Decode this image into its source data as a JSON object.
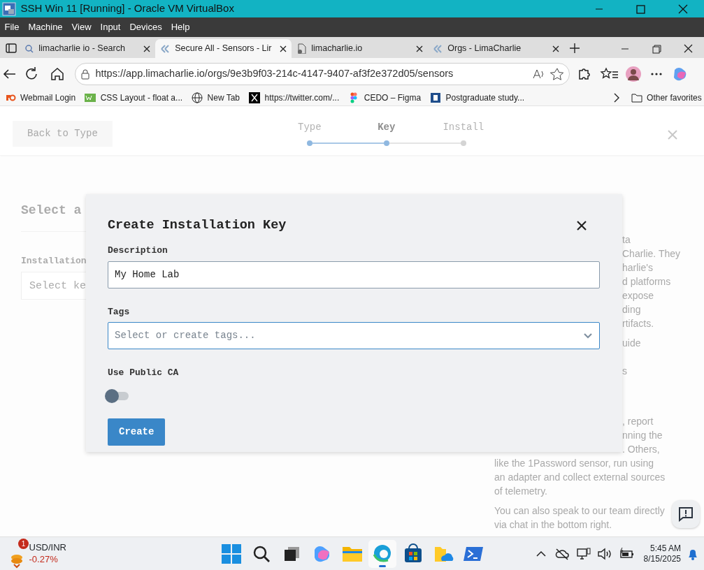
{
  "vm_window": {
    "title": "SSH Win 11 [Running] - Oracle VM VirtualBox"
  },
  "vm_menu": [
    "File",
    "Machine",
    "View",
    "Input",
    "Devices",
    "Help"
  ],
  "browser": {
    "tabs": [
      {
        "label": "limacharlie io - Search",
        "selected": false
      },
      {
        "label": "Secure All - Sensors - Lir",
        "selected": true
      },
      {
        "label": "limacharlie.io",
        "selected": false
      },
      {
        "label": "Orgs - LimaCharlie",
        "selected": false
      }
    ],
    "url": "https://app.limacharlie.io/orgs/9e3b9f03-214c-4147-9407-af3f2e372d05/sensors",
    "bookmarks": [
      "Webmail Login",
      "CSS Layout - float a...",
      "New Tab",
      "https://twitter.com/...",
      "CEDO – Figma",
      "Postgraduate study..."
    ],
    "other_favorites": "Other favorites"
  },
  "page": {
    "back_button": "Back to Type",
    "steps": [
      {
        "label": "Type",
        "selected": false,
        "done": true
      },
      {
        "label": "Key",
        "selected": true,
        "done": true
      },
      {
        "label": "Install",
        "selected": false,
        "done": false
      }
    ],
    "heading": "Select a",
    "field_label": "Installation",
    "field_placeholder": "Select ke",
    "paragraphs": [
      [
        {
          "text": "ta",
          "kind": "clipped"
        },
        {
          "text": "Charlie. They",
          "kind": "clipped"
        },
        {
          "text": "harlie's",
          "kind": "clipped"
        },
        {
          "text": "d platforms",
          "kind": "clipped"
        },
        {
          "text": "expose",
          "kind": "clipped"
        },
        {
          "text": "ding",
          "kind": "clipped"
        },
        {
          "text": "rtifacts.",
          "kind": "clipped"
        }
      ],
      [
        {
          "text": "uide",
          "kind": "clipped"
        }
      ],
      [
        {
          "text": "s",
          "kind": "clipped"
        }
      ],
      [
        {
          "text": ", report",
          "kind": "clipped"
        },
        {
          "text": "nning the",
          "kind": "clipped"
        },
        {
          "text": ". Others,",
          "kind": "clipped"
        },
        {
          "text": "like the 1Password sensor, run using",
          "kind": "full"
        },
        {
          "text": "an adapter and collect external sources",
          "kind": "full"
        },
        {
          "text": "of telemetry.",
          "kind": "full"
        }
      ],
      [
        {
          "text": "You can also speak to our team directly",
          "kind": "full"
        },
        {
          "text": "via chat in the bottom right.",
          "kind": "full"
        }
      ]
    ]
  },
  "modal": {
    "title": "Create Installation Key",
    "fields": [
      {
        "kind": "text",
        "label": "Description",
        "value": "My Home Lab"
      },
      {
        "kind": "select",
        "label": "Tags",
        "placeholder": "Select or create tags...",
        "focused": true
      },
      {
        "kind": "toggle",
        "label": "Use Public CA",
        "on": false
      }
    ],
    "submit": "Create"
  },
  "taskbar": {
    "widget": {
      "badge": "1",
      "title": "USD/INR",
      "change": "-0.27%"
    },
    "apps": [
      {
        "selected": false
      },
      {
        "selected": false
      },
      {
        "selected": false
      },
      {
        "selected": false
      },
      {
        "selected": false
      },
      {
        "selected": true
      },
      {
        "selected": false
      },
      {
        "selected": false
      },
      {
        "selected": false
      }
    ],
    "time": "5:45 AM",
    "date": "8/15/2025"
  }
}
